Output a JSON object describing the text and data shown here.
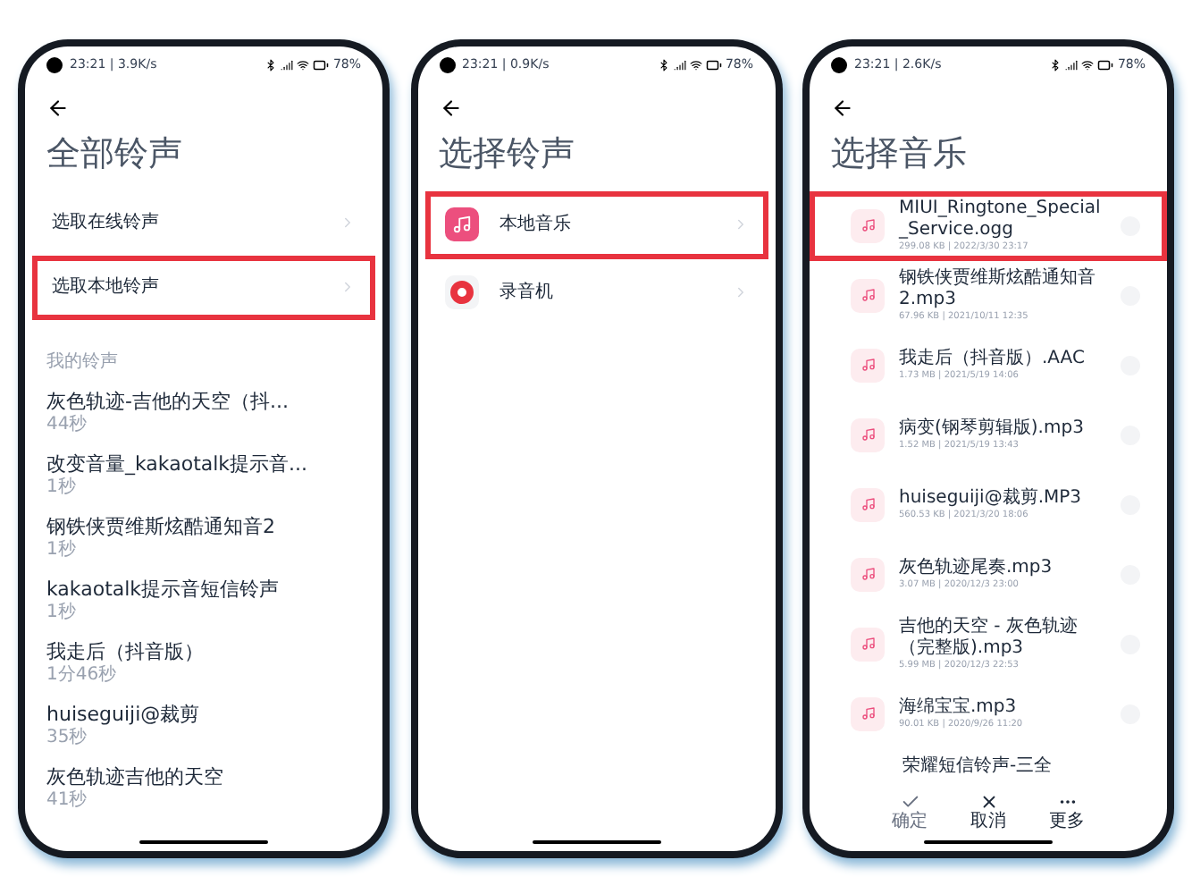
{
  "screens": [
    {
      "kind": "ringtones",
      "status_left": "23:21 | 3.9K/s",
      "battery": "78%",
      "title": "全部铃声",
      "menu": [
        {
          "label": "选取在线铃声",
          "highlighted": false
        },
        {
          "label": "选取本地铃声",
          "highlighted": true
        }
      ],
      "section": "我的铃声",
      "ringtones": [
        {
          "name": "灰色轨迹-吉他的天空（抖...",
          "duration": "44秒"
        },
        {
          "name": "改变音量_kakaotalk提示音...",
          "duration": "1秒"
        },
        {
          "name": "钢铁侠贾维斯炫酷通知音2",
          "duration": "1秒"
        },
        {
          "name": "kakaotalk提示音短信铃声",
          "duration": "1秒"
        },
        {
          "name": "我走后（抖音版）",
          "duration": "1分46秒"
        },
        {
          "name": "huiseguiji@裁剪",
          "duration": "35秒"
        },
        {
          "name": "灰色轨迹吉他的天空",
          "duration": "41秒"
        }
      ]
    },
    {
      "kind": "sources",
      "status_left": "23:21 | 0.9K/s",
      "battery": "78%",
      "title": "选择铃声",
      "sources": [
        {
          "label": "本地音乐",
          "kind": "music",
          "highlighted": true
        },
        {
          "label": "录音机",
          "kind": "recorder",
          "highlighted": false
        }
      ]
    },
    {
      "kind": "files",
      "status_left": "23:21 | 2.6K/s",
      "battery": "78%",
      "title": "选择音乐",
      "files": [
        {
          "name": "MIUI_Ringtone_Special_Service.ogg",
          "meta": "299.08 KB | 2022/3/30 23:17",
          "highlighted": true,
          "selected": false
        },
        {
          "name": "钢铁侠贾维斯炫酷通知音2.mp3",
          "meta": "67.96 KB | 2021/10/11 12:35",
          "highlighted": false,
          "selected": false
        },
        {
          "name": "我走后（抖音版）.AAC",
          "meta": "1.73 MB | 2021/5/19 14:06",
          "highlighted": false,
          "selected": false
        },
        {
          "name": "病变(钢琴剪辑版).mp3",
          "meta": "1.52 MB | 2021/5/19 13:43",
          "highlighted": false,
          "selected": false
        },
        {
          "name": "huiseguiji@裁剪.MP3",
          "meta": "560.53 KB | 2021/3/20 18:06",
          "highlighted": false,
          "selected": false
        },
        {
          "name": "灰色轨迹尾奏.mp3",
          "meta": "3.07 MB | 2020/12/3 23:00",
          "highlighted": false,
          "selected": false
        },
        {
          "name": "吉他的天空 - 灰色轨迹（完整版).mp3",
          "meta": "5.99 MB | 2020/12/3 22:53",
          "highlighted": false,
          "selected": false
        },
        {
          "name": "海绵宝宝.mp3",
          "meta": "90.01 KB | 2020/9/26 11:20",
          "highlighted": false,
          "selected": false
        }
      ],
      "partial_file": "荣耀短信铃声-三全",
      "actions": [
        {
          "label": "确定",
          "kind": "confirm",
          "disabled": true
        },
        {
          "label": "取消",
          "kind": "cancel",
          "disabled": false
        },
        {
          "label": "更多",
          "kind": "more",
          "disabled": false
        }
      ]
    }
  ]
}
